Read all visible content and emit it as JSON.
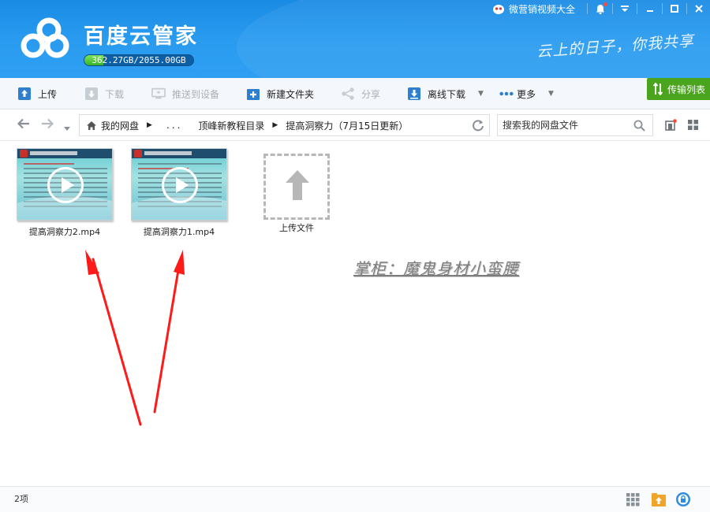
{
  "window": {
    "app_title": "百度云管家",
    "slogan": "云上的日子，你我共享",
    "quota_text": "362.27GB/2055.00GB",
    "quota_fraction": 0.176,
    "marketing_link": "微营销视频大全"
  },
  "toolbar": {
    "upload": "上传",
    "download": "下载",
    "push_device": "推送到设备",
    "new_folder": "新建文件夹",
    "share": "分享",
    "offline_download": "离线下载",
    "more": "更多",
    "transfer_list": "传输列表"
  },
  "nav": {
    "breadcrumbs": [
      "我的网盘",
      "...",
      "顶峰新教程目录",
      "提高洞察力（7月15日更新）"
    ],
    "search_placeholder": "搜索我的网盘文件"
  },
  "files": [
    {
      "name": "提高洞察力2.mp4"
    },
    {
      "name": "提高洞察力1.mp4"
    }
  ],
  "upload_tile": {
    "label": "上传文件"
  },
  "watermark": "掌柜：魔鬼身材小蛮腰",
  "status": {
    "count": "2项"
  },
  "colors": {
    "header_blue": "#2a9cf0",
    "accent_green": "#4aa41d",
    "arrow_red": "#ff1a1a"
  }
}
